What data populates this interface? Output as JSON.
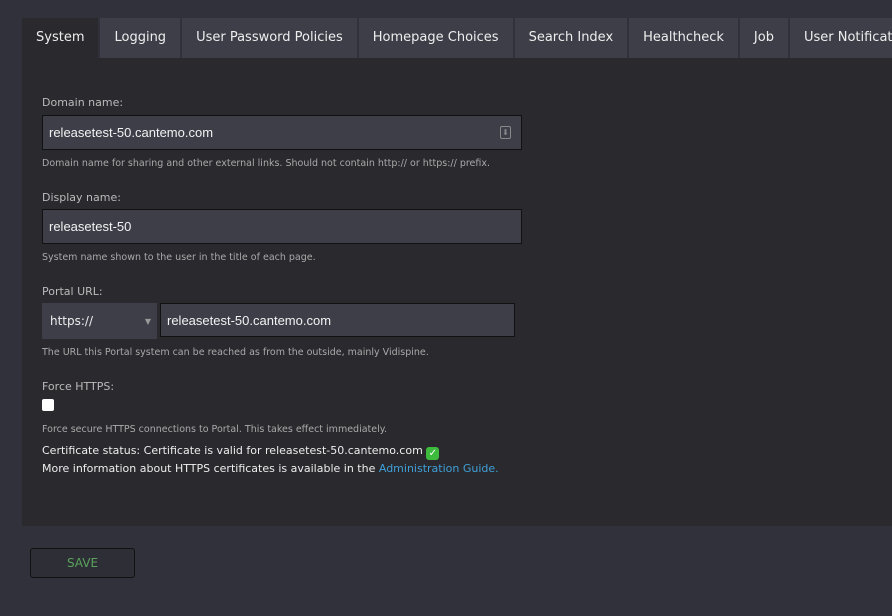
{
  "tabs": [
    {
      "label": "System"
    },
    {
      "label": "Logging"
    },
    {
      "label": "User Password Policies"
    },
    {
      "label": "Homepage Choices"
    },
    {
      "label": "Search Index"
    },
    {
      "label": "Healthcheck"
    },
    {
      "label": "Job"
    },
    {
      "label": "User Notifications"
    }
  ],
  "form": {
    "domain": {
      "label": "Domain name:",
      "value": "releasetest-50.cantemo.com",
      "help": "Domain name for sharing and other external links. Should not contain http:// or https:// prefix."
    },
    "display": {
      "label": "Display name:",
      "value": "releasetest-50",
      "help": "System name shown to the user in the title of each page."
    },
    "portal": {
      "label": "Portal URL:",
      "scheme": "https://",
      "value": "releasetest-50.cantemo.com",
      "help": "The URL this Portal system can be reached as from the outside, mainly Vidispine."
    },
    "https": {
      "label": "Force HTTPS:",
      "checked": false,
      "help": "Force secure HTTPS connections to Portal. This takes effect immediately."
    },
    "cert_status": "Certificate status: Certificate is valid for releasetest-50.cantemo.com",
    "more_info": "More information about HTTPS certificates is available in the",
    "guide_link": "Administration Guide."
  },
  "save_label": "SAVE",
  "colors": {
    "accent": "#5aa35a",
    "link": "#3fa0d8"
  }
}
